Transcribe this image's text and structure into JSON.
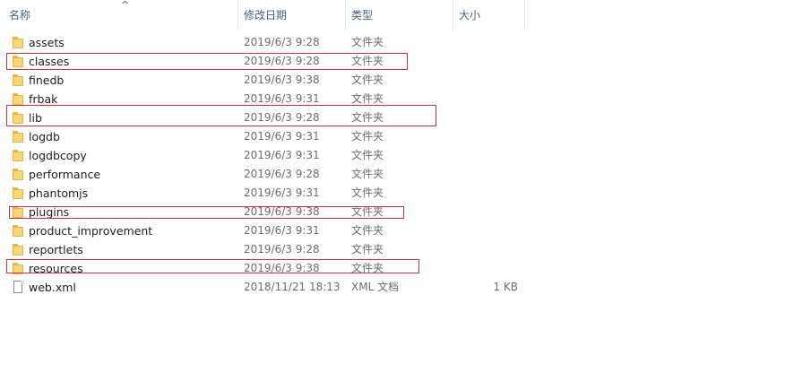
{
  "columns": {
    "name": "名称",
    "date": "修改日期",
    "type": "类型",
    "size": "大小",
    "sort_indicator": "^"
  },
  "files": [
    {
      "name": "assets",
      "date": "2019/6/3 9:28",
      "type": "文件夹",
      "size": "",
      "icon": "folder-icon"
    },
    {
      "name": "classes",
      "date": "2019/6/3 9:28",
      "type": "文件夹",
      "size": "",
      "icon": "folder-icon"
    },
    {
      "name": "finedb",
      "date": "2019/6/3 9:38",
      "type": "文件夹",
      "size": "",
      "icon": "folder-icon"
    },
    {
      "name": "frbak",
      "date": "2019/6/3 9:31",
      "type": "文件夹",
      "size": "",
      "icon": "folder-icon"
    },
    {
      "name": "lib",
      "date": "2019/6/3 9:28",
      "type": "文件夹",
      "size": "",
      "icon": "folder-icon"
    },
    {
      "name": "logdb",
      "date": "2019/6/3 9:31",
      "type": "文件夹",
      "size": "",
      "icon": "folder-icon"
    },
    {
      "name": "logdbcopy",
      "date": "2019/6/3 9:31",
      "type": "文件夹",
      "size": "",
      "icon": "folder-icon"
    },
    {
      "name": "performance",
      "date": "2019/6/3 9:28",
      "type": "文件夹",
      "size": "",
      "icon": "folder-icon"
    },
    {
      "name": "phantomjs",
      "date": "2019/6/3 9:31",
      "type": "文件夹",
      "size": "",
      "icon": "folder-icon"
    },
    {
      "name": "plugins",
      "date": "2019/6/3 9:38",
      "type": "文件夹",
      "size": "",
      "icon": "folder-icon"
    },
    {
      "name": "product_improvement",
      "date": "2019/6/3 9:31",
      "type": "文件夹",
      "size": "",
      "icon": "folder-icon"
    },
    {
      "name": "reportlets",
      "date": "2019/6/3 9:28",
      "type": "文件夹",
      "size": "",
      "icon": "folder-icon"
    },
    {
      "name": "resources",
      "date": "2019/6/3 9:38",
      "type": "文件夹",
      "size": "",
      "icon": "folder-icon"
    },
    {
      "name": "web.xml",
      "date": "2018/11/21 18:13",
      "type": "XML 文档",
      "size": "1 KB",
      "icon": "xml-file-icon"
    }
  ],
  "colors": {
    "highlight": "#d0343a",
    "header_text": "#4c607a",
    "folder": "#f8d775"
  }
}
